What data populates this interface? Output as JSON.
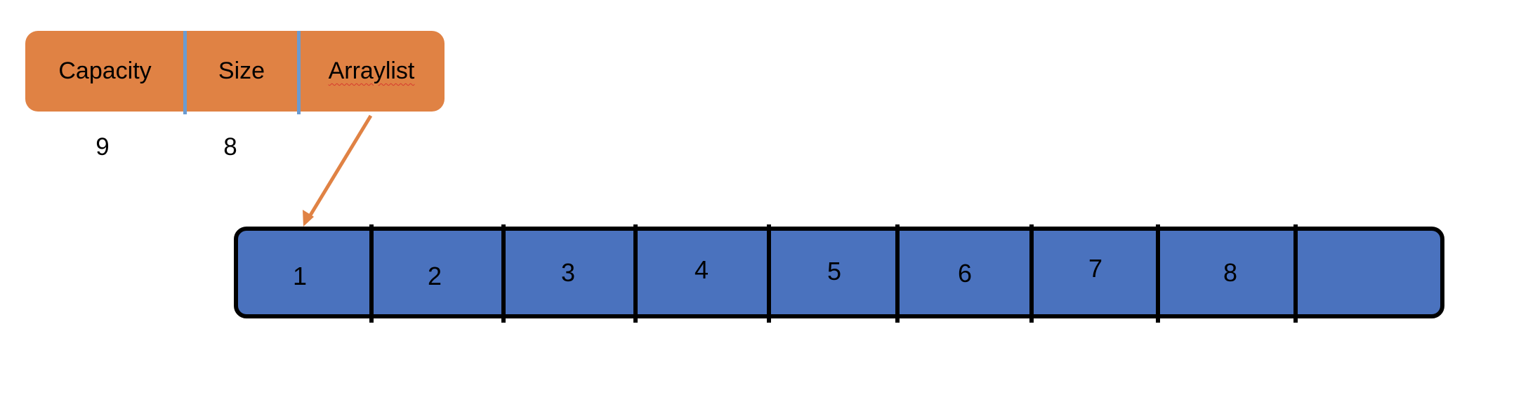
{
  "header": {
    "fields": [
      "Capacity",
      "Size",
      "Arraylist"
    ],
    "values": {
      "capacity": "9",
      "size": "8"
    }
  },
  "array": {
    "capacity": 9,
    "size": 8,
    "cells": [
      "1",
      "2",
      "3",
      "4",
      "5",
      "6",
      "7",
      "8",
      ""
    ]
  },
  "colors": {
    "header_fill": "#E08244",
    "header_divider": "#6A9BD1",
    "array_fill": "#4A72BE",
    "pointer_arrow": "#E08244",
    "border": "#000000"
  },
  "pointer": {
    "from": "Arraylist",
    "to": "array-cell-0",
    "icon": "arrow-pointer-icon"
  }
}
